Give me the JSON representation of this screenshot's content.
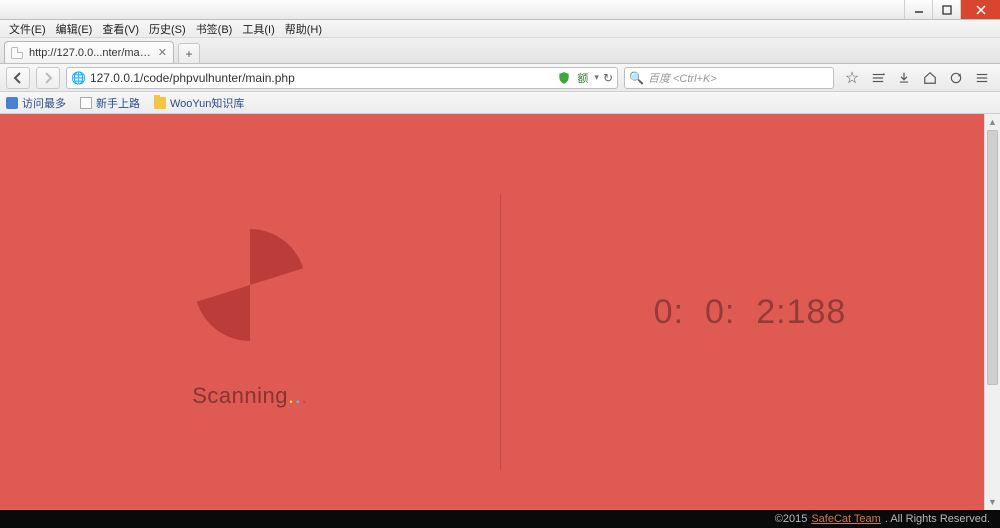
{
  "menus": [
    "文件(E)",
    "编辑(E)",
    "查看(V)",
    "历史(S)",
    "书签(B)",
    "工具(I)",
    "帮助(H)"
  ],
  "tab": {
    "title": "http://127.0.0...nter/main.php"
  },
  "url": "127.0.0.1/code/phpvulhunter/main.php",
  "proxy_label": "额",
  "search": {
    "placeholder": "百度 <Ctrl+K>"
  },
  "bookmarks": [
    {
      "icon": "blue",
      "label": "访问最多"
    },
    {
      "icon": "doc",
      "label": "新手上路"
    },
    {
      "icon": "folder",
      "label": "WooYun知识库"
    }
  ],
  "scan": {
    "label": "Scanning"
  },
  "timer": {
    "h": "0",
    "m": "0",
    "s": "2",
    "ms": "188"
  },
  "footer": {
    "copyright": "©2015",
    "team": "SafeCat Team",
    "rights": ". All Rights Reserved."
  }
}
